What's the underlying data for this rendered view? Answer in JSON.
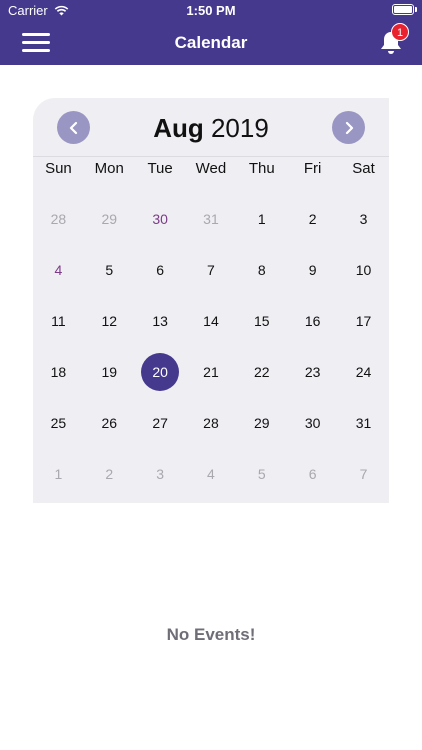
{
  "status_bar": {
    "carrier": "Carrier",
    "time": "1:50 PM"
  },
  "navbar": {
    "title": "Calendar",
    "notification_count": "1"
  },
  "calendar": {
    "month": "Aug",
    "year": "2019",
    "weekdays": [
      "Sun",
      "Mon",
      "Tue",
      "Wed",
      "Thu",
      "Fri",
      "Sat"
    ],
    "weeks": [
      [
        "28",
        "29",
        "30",
        "31",
        "1",
        "2",
        "3"
      ],
      [
        "4",
        "5",
        "6",
        "7",
        "8",
        "9",
        "10"
      ],
      [
        "11",
        "12",
        "13",
        "14",
        "15",
        "16",
        "17"
      ],
      [
        "18",
        "19",
        "20",
        "21",
        "22",
        "23",
        "24"
      ],
      [
        "25",
        "26",
        "27",
        "28",
        "29",
        "30",
        "31"
      ],
      [
        "1",
        "2",
        "3",
        "4",
        "5",
        "6",
        "7"
      ]
    ],
    "selected_day": "20"
  },
  "events": {
    "empty_message": "No Events!"
  },
  "colors": {
    "brand": "#45398e",
    "badge": "#e8232f",
    "arrow": "#9a96c4",
    "calendar_bg": "#efeef3"
  }
}
